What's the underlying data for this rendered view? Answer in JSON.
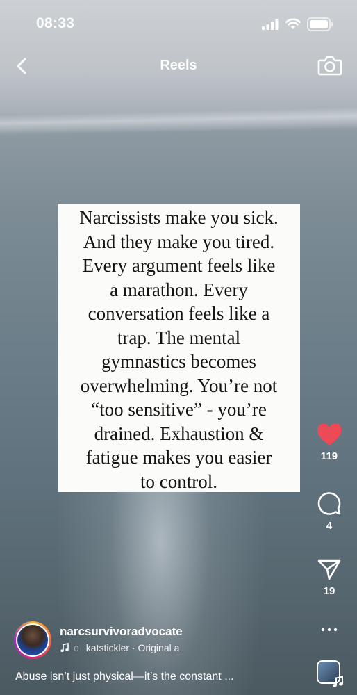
{
  "status_bar": {
    "time": "08:33"
  },
  "nav": {
    "title": "Reels"
  },
  "post": {
    "text_lines": [
      "Narcissists make you sick.",
      "And they make you tired.",
      "Every argument feels like",
      "a marathon. Every",
      "conversation feels like a",
      "trap. The mental",
      "gymnastics becomes",
      "overwhelming. You’re not",
      "“too sensitive” - you’re",
      "drained. Exhaustion &",
      "fatigue makes you easier",
      "to control."
    ]
  },
  "actions": {
    "likes": "119",
    "comments": "4",
    "shares": "19",
    "like_color": "#ed4956"
  },
  "footer": {
    "username": "narcsurvivoradvocate",
    "music_dim": "o",
    "music_text": "katstickler · Original a",
    "caption": "Abuse isn’t just physical—it’s the constant ..."
  },
  "icons": {
    "back": "chevron-left-icon",
    "camera": "camera-icon",
    "like": "heart-icon",
    "comment": "comment-icon",
    "share": "send-icon",
    "more": "more-dots-icon",
    "music": "music-note-icon"
  }
}
